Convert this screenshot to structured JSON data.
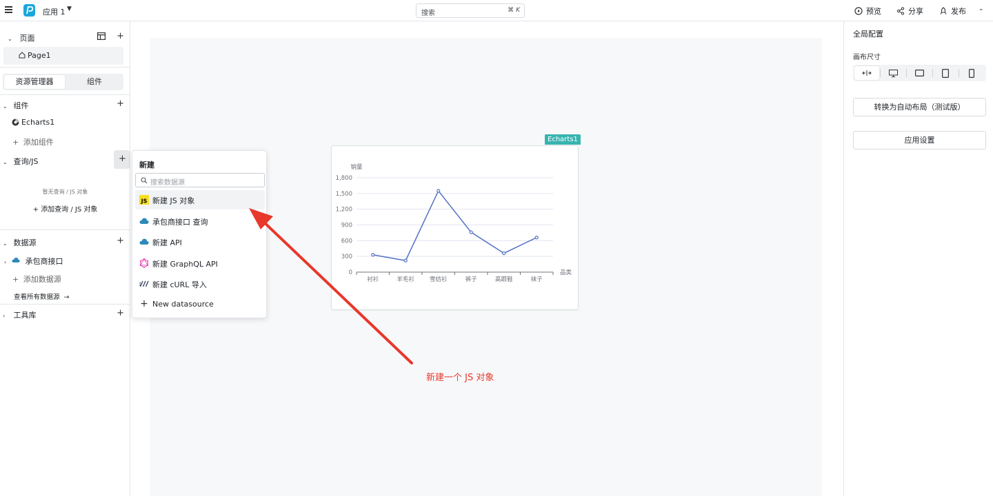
{
  "topbar": {
    "app_name": "应用 1",
    "search_placeholder": "搜索",
    "search_shortcut": "⌘ K",
    "preview_label": "预览",
    "share_label": "分享",
    "publish_label": "发布"
  },
  "sidebar": {
    "pages_header": "页面",
    "page_item": "Page1",
    "tabs": [
      "资源管理器",
      "组件"
    ],
    "components_header": "组件",
    "component_item": "Echarts1",
    "add_component": "添加组件",
    "query_header": "查询/JS",
    "query_empty": "暂无查询 / JS 对象",
    "add_query": "添加查询 / JS 对象",
    "datasource_header": "数据源",
    "datasource_item": "承包商接口",
    "add_datasource": "添加数据源",
    "view_all_datasources": "查看所有数据源",
    "library_header": "工具库"
  },
  "popup": {
    "title": "新建",
    "search_placeholder": "搜索数据源",
    "items": [
      {
        "label": "新建 JS 对象",
        "icon": "js-icon"
      },
      {
        "label": "承包商接口 查询",
        "icon": "cloud-icon"
      },
      {
        "label": "新建 API",
        "icon": "cloud-icon"
      },
      {
        "label": "新建 GraphQL API",
        "icon": "graphql-icon"
      },
      {
        "label": "新建 cURL 导入",
        "icon": "curl-icon"
      },
      {
        "label": "New datasource",
        "icon": "plus-icon"
      }
    ]
  },
  "widget": {
    "tag": "Echarts1"
  },
  "chart_data": {
    "type": "line",
    "title": "",
    "ylabel": "销量",
    "xlabel": "品类",
    "categories": [
      "衬衫",
      "羊毛衫",
      "雪纺衫",
      "裤子",
      "高跟鞋",
      "袜子"
    ],
    "values": [
      330,
      220,
      1550,
      760,
      360,
      660
    ],
    "ylim": [
      0,
      1800
    ],
    "yticks": [
      "0",
      "300",
      "600",
      "900",
      "1,200",
      "1,500",
      "1,800"
    ],
    "grid": true,
    "color": "#5470c6"
  },
  "right_panel": {
    "title": "全局配置",
    "canvas_size_label": "画布尺寸",
    "size_icons": [
      "fluid-icon",
      "desktop-icon",
      "tablet-landscape-icon",
      "tablet-portrait-icon",
      "mobile-icon"
    ],
    "auto_layout_button": "转换为自动布局（测试版）",
    "app_settings_button": "应用设置"
  },
  "annotation": {
    "text": "新建一个 JS 对象",
    "color": "#e8372b"
  }
}
